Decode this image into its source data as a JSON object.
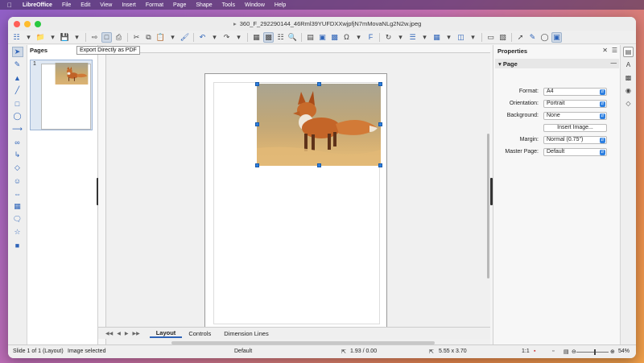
{
  "menubar": {
    "app": "LibreOffice",
    "items": [
      "File",
      "Edit",
      "View",
      "Insert",
      "Format",
      "Page",
      "Shape",
      "Tools",
      "Window",
      "Help"
    ]
  },
  "window": {
    "title": "360_F_292290144_46Rml39YUFDXXwjpfjN7mMovaNLg2N2w.jpeg"
  },
  "toolbar": {
    "tooltip": "Export Directly as PDF"
  },
  "pages_pane": {
    "title": "Pages",
    "thumb_number": "1"
  },
  "tabs": {
    "items": [
      "Layout",
      "Controls",
      "Dimension Lines"
    ],
    "active": "Layout"
  },
  "properties": {
    "title": "Properties",
    "section": "Page",
    "format_label": "Format:",
    "format_value": "A4",
    "orientation_label": "Orientation:",
    "orientation_value": "Portrait",
    "background_label": "Background:",
    "background_value": "None",
    "insert_image": "Insert Image...",
    "margin_label": "Margin:",
    "margin_value": "Normal (0.75\")",
    "master_label": "Master Page:",
    "master_value": "Default"
  },
  "statusbar": {
    "slide": "Slide 1 of 1 (Layout)",
    "selection": "Image selected",
    "master": "Default",
    "position": "1.93 / 0.00",
    "size": "5.55 x 3.70",
    "scale": "1:1",
    "zoom": "54%"
  },
  "colors": {
    "accent": "#2d63b8",
    "handle": "#2d7fe0"
  }
}
